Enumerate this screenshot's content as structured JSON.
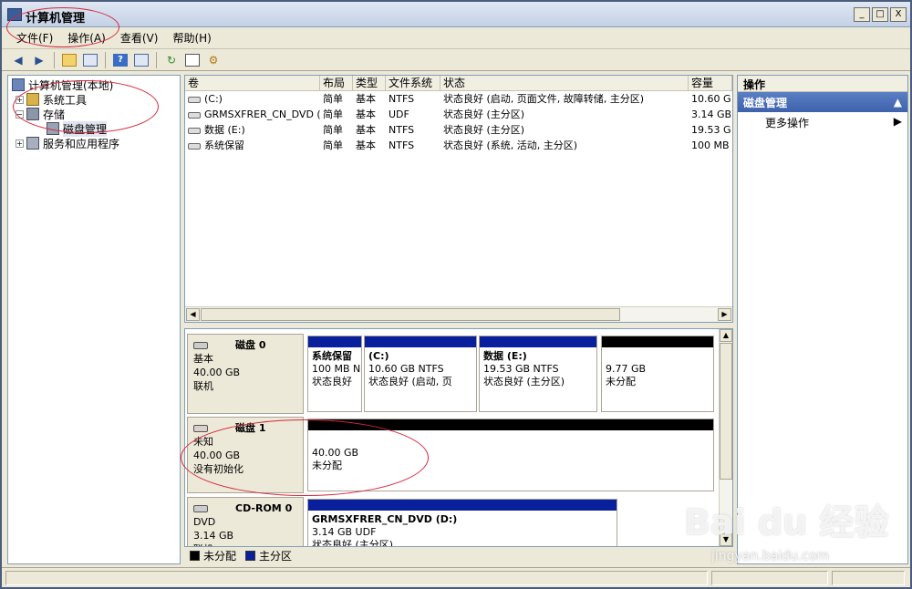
{
  "window": {
    "title": "计算机管理",
    "btn_min": "_",
    "btn_max": "□",
    "btn_close": "X"
  },
  "menu": [
    "文件(F)",
    "操作(A)",
    "查看(V)",
    "帮助(H)"
  ],
  "toolbar": {
    "icons": [
      "back-arrow-icon",
      "forward-arrow-icon",
      "up-folder-icon",
      "show-hide-tree-icon",
      "help-icon",
      "export-icon",
      "refresh-icon",
      "properties-icon",
      "settings-icon"
    ]
  },
  "tree": {
    "root": "计算机管理(本地)",
    "system_tools": "系统工具",
    "storage": "存储",
    "disk_mgmt": "磁盘管理",
    "services": "服务和应用程序"
  },
  "volumes": {
    "columns": [
      "卷",
      "布局",
      "类型",
      "文件系统",
      "状态",
      "容量"
    ],
    "rows": [
      {
        "name": "(C:)",
        "layout": "简单",
        "type": "基本",
        "fs": "NTFS",
        "status": "状态良好 (启动, 页面文件, 故障转储, 主分区)",
        "cap": "10.60 G"
      },
      {
        "name": "GRMSXFRER_CN_DVD (D:)",
        "layout": "简单",
        "type": "基本",
        "fs": "UDF",
        "status": "状态良好 (主分区)",
        "cap": "3.14 GB"
      },
      {
        "name": "数据 (E:)",
        "layout": "简单",
        "type": "基本",
        "fs": "NTFS",
        "status": "状态良好 (主分区)",
        "cap": "19.53 G"
      },
      {
        "name": "系统保留",
        "layout": "简单",
        "type": "基本",
        "fs": "NTFS",
        "status": "状态良好 (系统, 活动, 主分区)",
        "cap": "100 MB"
      }
    ]
  },
  "disks": {
    "disk0": {
      "name": "磁盘 0",
      "type": "基本",
      "size": "40.00 GB",
      "status": "联机",
      "parts": [
        {
          "title": "系统保留",
          "line2": "100 MB N",
          "line3": "状态良好"
        },
        {
          "title": "(C:)",
          "line2": "10.60 GB NTFS",
          "line3": "状态良好 (启动, 页"
        },
        {
          "title": "数据  (E:)",
          "line2": "19.53 GB NTFS",
          "line3": "状态良好 (主分区)"
        },
        {
          "title": "",
          "line2": "9.77 GB",
          "line3": "未分配"
        }
      ]
    },
    "disk1": {
      "name": "磁盘 1",
      "type": "未知",
      "size": "40.00 GB",
      "status": "没有初始化",
      "part": {
        "line1": "40.00 GB",
        "line2": "未分配"
      }
    },
    "cdrom0": {
      "name": "CD-ROM 0",
      "type": "DVD",
      "size": "3.14 GB",
      "status": "联机",
      "part": {
        "title": "GRMSXFRER_CN_DVD  (D:)",
        "line2": "3.14 GB UDF",
        "line3": "状态良好 (主分区)"
      }
    }
  },
  "legend": [
    {
      "label": "未分配",
      "color": "#000000"
    },
    {
      "label": "主分区",
      "color": "#0a1f9b"
    }
  ],
  "actions": {
    "title": "操作",
    "section": "磁盘管理",
    "more": "更多操作"
  },
  "watermark": {
    "main": "Bai du 经验",
    "sub": "jingyan.baidu.com"
  },
  "colors": {
    "primary_partition": "#0a1f9b",
    "unallocated": "#000000",
    "annotation": "#d7263d",
    "section_blue": "#3d62ab"
  }
}
